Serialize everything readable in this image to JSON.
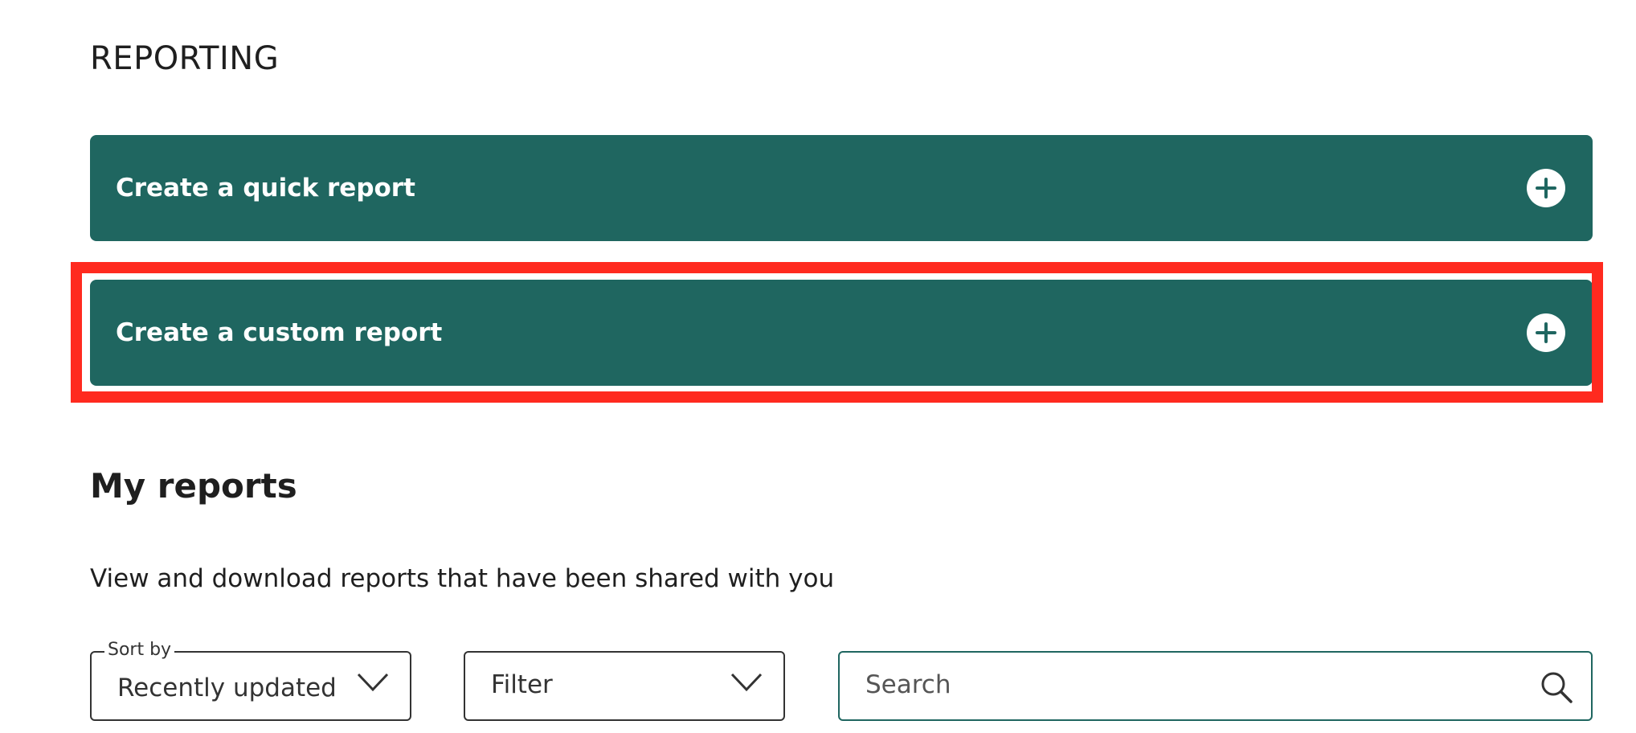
{
  "page": {
    "title": "REPORTING"
  },
  "actions": {
    "quick_report_label": "Create a quick report",
    "custom_report_label": "Create a custom report"
  },
  "my_reports": {
    "title": "My reports",
    "description": "View and download reports that have been shared with you"
  },
  "controls": {
    "sort": {
      "label": "Sort by",
      "value": "Recently updated"
    },
    "filter": {
      "value": "Filter"
    },
    "search": {
      "placeholder": "Search"
    }
  },
  "colors": {
    "accent": "#1f6660",
    "highlight": "#ff2a1f"
  },
  "icons": {
    "expand": "plus-circle-icon",
    "dropdown": "chevron-down-icon",
    "search": "search-icon"
  }
}
